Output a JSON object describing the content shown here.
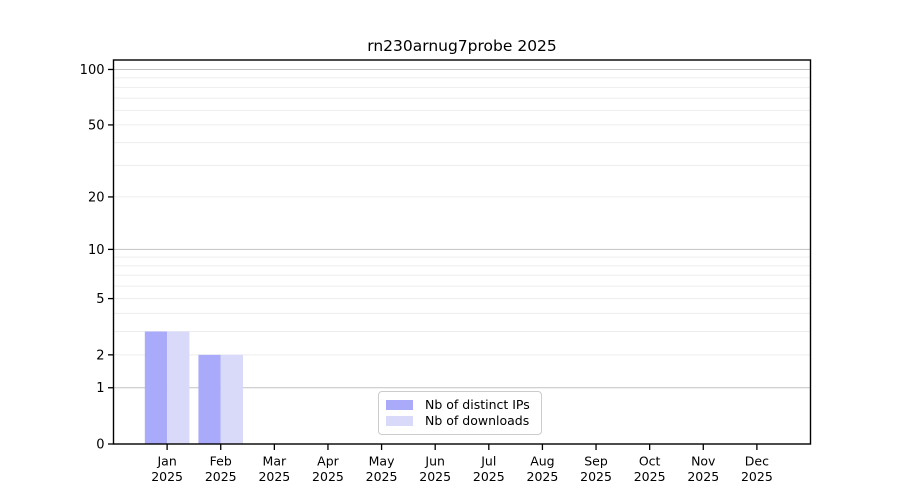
{
  "chart_data": {
    "type": "bar",
    "title": "rn230arnug7probe 2025",
    "categories": [
      "Jan",
      "Feb",
      "Mar",
      "Apr",
      "May",
      "Jun",
      "Jul",
      "Aug",
      "Sep",
      "Oct",
      "Nov",
      "Dec"
    ],
    "year_label": "2025",
    "series": [
      {
        "name": "Nb of distinct IPs",
        "color": "#aaaafa",
        "values": [
          3,
          2,
          0,
          0,
          0,
          0,
          0,
          0,
          0,
          0,
          0,
          0
        ]
      },
      {
        "name": "Nb of downloads",
        "color": "#d9d9fa",
        "values": [
          3,
          2,
          0,
          0,
          0,
          0,
          0,
          0,
          0,
          0,
          0,
          0
        ]
      }
    ],
    "yscale": "log1p",
    "ylim": [
      0,
      112
    ],
    "ytick_values": [
      0,
      1,
      2,
      5,
      10,
      20,
      50,
      100
    ],
    "ytick_labels": [
      "0",
      "1",
      "2",
      "5",
      "10",
      "20",
      "50",
      "100"
    ],
    "major_grid_values": [
      1,
      10,
      100
    ],
    "minor_grid_values": [
      2,
      3,
      4,
      5,
      6,
      7,
      8,
      9,
      20,
      30,
      40,
      50,
      60,
      70,
      80,
      90
    ],
    "grid": true,
    "legend_position": "lower center inside axes"
  },
  "colors": {
    "background": "#ffffff",
    "axis": "#000000",
    "text": "#000000",
    "grid_major": "#c2c2c2",
    "grid_minor": "#ededed",
    "legend_border": "#cccccc"
  }
}
